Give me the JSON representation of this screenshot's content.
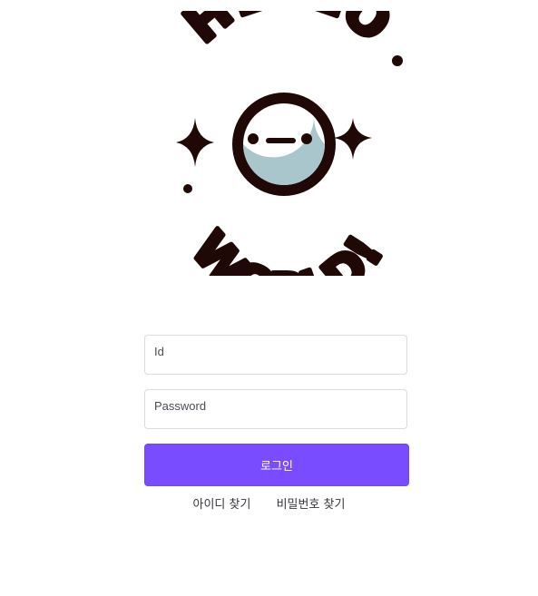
{
  "logo": {
    "line1": "HELLO",
    "line2": "WORLD!",
    "colors": {
      "ink": "#1f0805",
      "face": "#ffffff",
      "shadow": "#a8c6cc"
    }
  },
  "login_form": {
    "id_placeholder": "Id",
    "id_value": "",
    "password_placeholder": "Password",
    "password_value": "",
    "submit_label": "로그인"
  },
  "links": {
    "find_id": "아이디 찾기",
    "find_password": "비밀번호 찾기"
  },
  "colors": {
    "accent": "#7a4cff",
    "input_border": "#dcdcde",
    "text": "#33363b"
  }
}
